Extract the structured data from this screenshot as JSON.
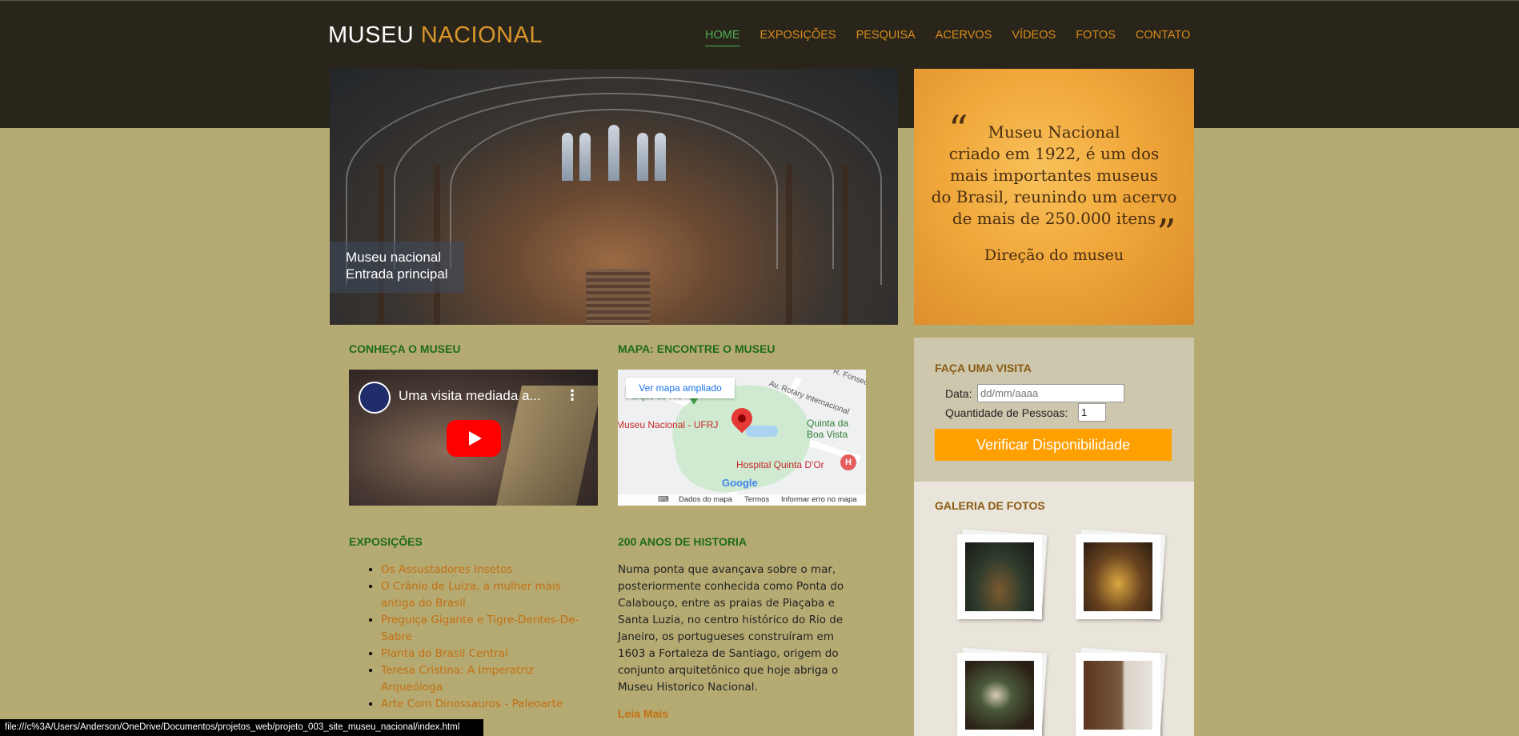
{
  "header": {
    "logo_part1": "MUSEU",
    "logo_part2": "NACIONAL",
    "nav": [
      {
        "label": "HOME",
        "active": true
      },
      {
        "label": "EXPOSIÇÕES"
      },
      {
        "label": "PESQUISA"
      },
      {
        "label": "ACERVOS"
      },
      {
        "label": "VÍDEOS"
      },
      {
        "label": "FOTOS"
      },
      {
        "label": "CONTATO"
      }
    ]
  },
  "hero": {
    "caption_line1": "Museu nacional",
    "caption_line2": "Entrada principal"
  },
  "quote": {
    "open_mark": "“",
    "close_mark": "”",
    "lines": [
      "Museu Nacional",
      "criado em 1922, é um dos",
      "mais importantes museus",
      "do Brasil, reunindo um acervo",
      "de mais de 250.000 itens"
    ],
    "signature": "Direção do museu"
  },
  "visit": {
    "title": "FAÇA UMA VISITA",
    "date_label": "Data:",
    "date_placeholder": "dd/mm/aaaa",
    "people_label": "Quantidade de Pessoas:",
    "people_value": "1",
    "button_label": "Verificar Disponibilidade"
  },
  "gallery": {
    "title": "GALERIA DE FOTOS"
  },
  "sections": {
    "conheca_title": "CONHEÇA O MUSEU",
    "mapa_title": "MAPA: ENCONTRE O MUSEU",
    "exposicoes_title": "EXPOSIÇÕES",
    "historia_title": "200 ANOS DE HISTORIA"
  },
  "video": {
    "title": "Uma visita mediada a..."
  },
  "map": {
    "button_label": "Ver mapa ampliado",
    "label_parque": "Parque do Rio",
    "label_museu": "Museu Nacional - UFRJ",
    "label_quinta_1": "Quinta da",
    "label_quinta_2": "Boa Vista",
    "label_hospital": "Hospital Quinta D'Or",
    "label_rotary": "Av. Rotary Internacional",
    "label_rfonseca": "R. Fonsec",
    "google": "Google",
    "footer_dados": "Dados do mapa",
    "footer_termos": "Termos",
    "footer_erro": "Informar erro no mapa",
    "hospital_marker": "H"
  },
  "exposicoes": [
    "Os Assustadores Insetos",
    "O Crânio de Luiza, a mulher mais antiga do Brasil",
    "Preguiça Gigante e Tigre-Dentes-De-Sabre",
    "Planta do Brasil Central",
    "Teresa Cristina: A Imperatriz Arqueóloga",
    "Arte Com Dinossauros - Paleoarte"
  ],
  "historia": {
    "text": "Numa ponta que avançava sobre o mar, posteriormente conhecida como Ponta do Calabouço, entre as praias de Piaçaba e Santa Luzia, no centro histórico do Rio de Janeiro, os portugueses construíram em 1603 a Fortaleza de Santiago, origem do conjunto arquitetônico que hoje abriga o Museu Historico Nacional.",
    "more_label": "Leia Mais"
  },
  "statusbar": {
    "url": "file:///c%3A/Users/Anderson/OneDrive/Documentos/projetos_web/projeto_003_site_museu_nacional/index.html"
  },
  "colors": {
    "header_bg": "#29251b",
    "page_bg": "#b5aa72",
    "accent_orange": "#d88a1a",
    "active_green": "#4caf50",
    "button_orange": "#ff9f00"
  },
  "icons": {
    "play": "youtube-play-icon",
    "map_pin": "map-pin-icon",
    "keyboard": "keyboard-icon"
  }
}
